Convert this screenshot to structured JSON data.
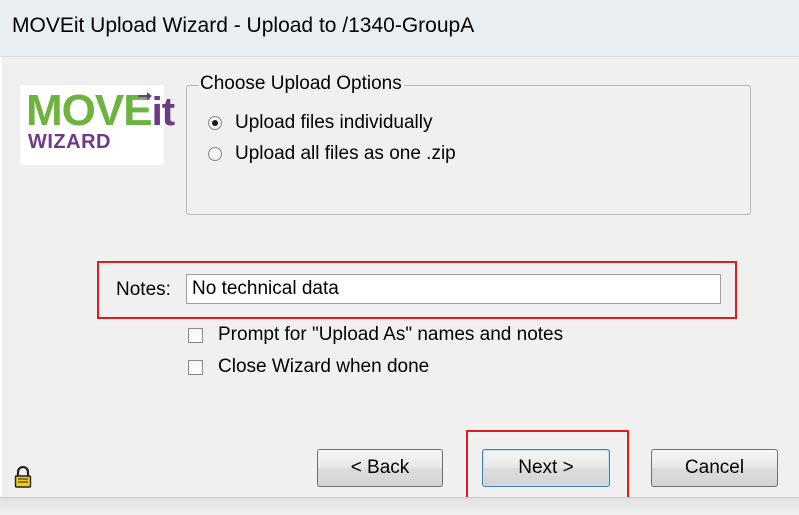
{
  "window": {
    "title": "MOVEit Upload Wizard - Upload to /1340-GroupA"
  },
  "logo": {
    "word_move": "MOVE",
    "word_it": "it",
    "word_wizard": "WIZARD"
  },
  "upload_options": {
    "legend": "Choose Upload Options",
    "options": [
      {
        "label": "Upload files individually",
        "checked": true
      },
      {
        "label": "Upload all files as one .zip",
        "checked": false
      }
    ]
  },
  "notes": {
    "label": "Notes:",
    "value": "No technical data"
  },
  "checkboxes": [
    {
      "label": "Prompt for \"Upload As\" names and notes",
      "checked": false
    },
    {
      "label": "Close Wizard when done",
      "checked": false
    }
  ],
  "buttons": {
    "back": "< Back",
    "next": "Next >",
    "cancel": "Cancel"
  },
  "icons": {
    "lock": "lock-icon"
  },
  "colors": {
    "highlight": "#dd1c1c",
    "logo_green": "#6db33f",
    "logo_purple": "#6d3a86"
  }
}
